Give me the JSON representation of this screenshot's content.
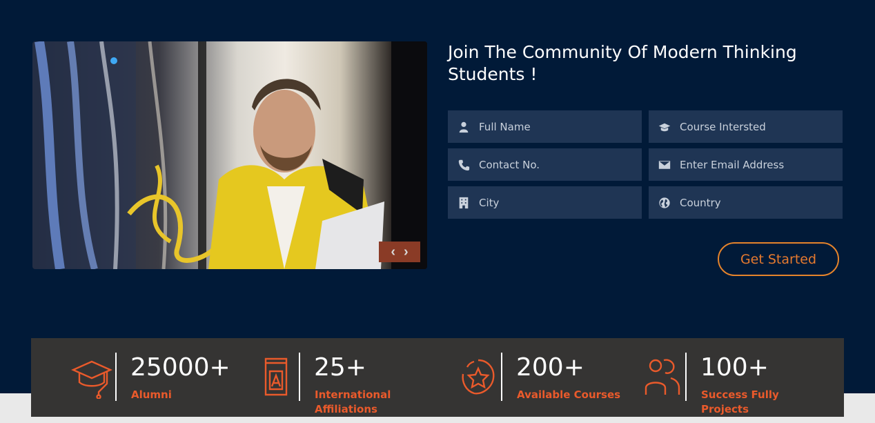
{
  "form": {
    "title_line1": "Join The Community Of Modern Thinking",
    "title_line2": "Students !",
    "fields": [
      {
        "placeholder": "Full Name",
        "icon": "user-icon"
      },
      {
        "placeholder": "Course Intersted",
        "icon": "graduation-cap-icon"
      },
      {
        "placeholder": "Contact No.",
        "icon": "phone-icon"
      },
      {
        "placeholder": "Enter Email Address",
        "icon": "envelope-icon"
      },
      {
        "placeholder": "City",
        "icon": "building-icon"
      },
      {
        "placeholder": "Country",
        "icon": "globe-icon"
      }
    ],
    "submit_label": "Get Started"
  },
  "slider": {
    "prev_label": "‹",
    "next_label": "›"
  },
  "stats": [
    {
      "value": "25000+",
      "label_line1": "Alumni",
      "label_line2": "",
      "icon": "graduation-cap-icon"
    },
    {
      "value": "25+",
      "label_line1": "International",
      "label_line2": "Affiliations",
      "icon": "book-icon"
    },
    {
      "value": "200+",
      "label_line1": "Available Courses",
      "label_line2": "",
      "icon": "star-badge-icon"
    },
    {
      "value": "100+",
      "label_line1": "Success Fully",
      "label_line2": "Projects",
      "icon": "users-icon"
    }
  ],
  "colors": {
    "background": "#011a38",
    "field_bg": "#1f3554",
    "accent": "#ea5a2b",
    "button_border": "#e6842b",
    "stats_bg": "#353433"
  }
}
